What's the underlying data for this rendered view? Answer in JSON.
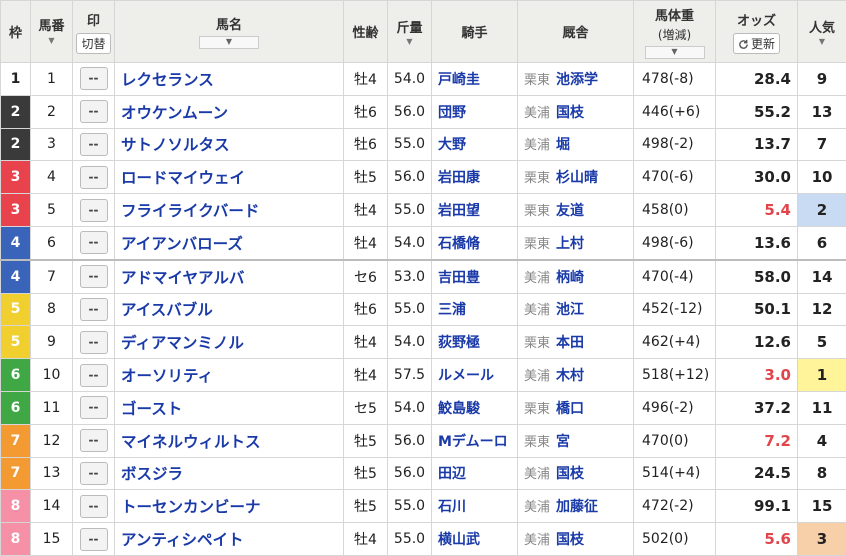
{
  "header": {
    "waku": "枠",
    "umaban": "馬番",
    "mark": "印",
    "mark_switch": "切替",
    "name": "馬名",
    "sexage": "性齢",
    "kinryo": "斤量",
    "jockey": "騎手",
    "stable": "厩舎",
    "weight": "馬体重",
    "weight_sub": "(増減)",
    "odds": "オッズ",
    "refresh": "更新",
    "popularity": "人気"
  },
  "rows": [
    {
      "waku": "1",
      "umaban": "1",
      "mark": "--",
      "name": "レクセランス",
      "sexage": "牡4",
      "kinryo": "54.0",
      "jockey": "戸崎圭",
      "belong": "栗東",
      "trainer": "池添学",
      "weight": "478(-8)",
      "odds": "28.4",
      "pop": "9"
    },
    {
      "waku": "2",
      "umaban": "2",
      "mark": "--",
      "name": "オウケンムーン",
      "sexage": "牡6",
      "kinryo": "56.0",
      "jockey": "団野",
      "belong": "美浦",
      "trainer": "国枝",
      "weight": "446(+6)",
      "odds": "55.2",
      "pop": "13"
    },
    {
      "waku": "2",
      "umaban": "3",
      "mark": "--",
      "name": "サトノソルタス",
      "sexage": "牡6",
      "kinryo": "55.0",
      "jockey": "大野",
      "belong": "美浦",
      "trainer": "堀",
      "weight": "498(-2)",
      "odds": "13.7",
      "pop": "7"
    },
    {
      "waku": "3",
      "umaban": "4",
      "mark": "--",
      "name": "ロードマイウェイ",
      "sexage": "牡5",
      "kinryo": "56.0",
      "jockey": "岩田康",
      "belong": "栗東",
      "trainer": "杉山晴",
      "weight": "470(-6)",
      "odds": "30.0",
      "pop": "10"
    },
    {
      "waku": "3",
      "umaban": "5",
      "mark": "--",
      "name": "フライライクバード",
      "sexage": "牡4",
      "kinryo": "55.0",
      "jockey": "岩田望",
      "belong": "栗東",
      "trainer": "友道",
      "weight": "458(0)",
      "odds": "5.4",
      "pop": "2"
    },
    {
      "waku": "4",
      "umaban": "6",
      "mark": "--",
      "name": "アイアンバローズ",
      "sexage": "牡4",
      "kinryo": "54.0",
      "jockey": "石橋脩",
      "belong": "栗東",
      "trainer": "上村",
      "weight": "498(-6)",
      "odds": "13.6",
      "pop": "6"
    },
    {
      "waku": "4",
      "umaban": "7",
      "mark": "--",
      "name": "アドマイヤアルバ",
      "sexage": "セ6",
      "kinryo": "53.0",
      "jockey": "吉田豊",
      "belong": "美浦",
      "trainer": "柄崎",
      "weight": "470(-4)",
      "odds": "58.0",
      "pop": "14"
    },
    {
      "waku": "5",
      "umaban": "8",
      "mark": "--",
      "name": "アイスバブル",
      "sexage": "牡6",
      "kinryo": "55.0",
      "jockey": "三浦",
      "belong": "美浦",
      "trainer": "池江",
      "weight": "452(-12)",
      "odds": "50.1",
      "pop": "12"
    },
    {
      "waku": "5",
      "umaban": "9",
      "mark": "--",
      "name": "ディアマンミノル",
      "sexage": "牡4",
      "kinryo": "54.0",
      "jockey": "荻野極",
      "belong": "栗東",
      "trainer": "本田",
      "weight": "462(+4)",
      "odds": "12.6",
      "pop": "5"
    },
    {
      "waku": "6",
      "umaban": "10",
      "mark": "--",
      "name": "オーソリティ",
      "sexage": "牡4",
      "kinryo": "57.5",
      "jockey": "ルメール",
      "belong": "美浦",
      "trainer": "木村",
      "weight": "518(+12)",
      "odds": "3.0",
      "pop": "1"
    },
    {
      "waku": "6",
      "umaban": "11",
      "mark": "--",
      "name": "ゴースト",
      "sexage": "セ5",
      "kinryo": "54.0",
      "jockey": "鮫島駿",
      "belong": "栗東",
      "trainer": "橋口",
      "weight": "496(-2)",
      "odds": "37.2",
      "pop": "11"
    },
    {
      "waku": "7",
      "umaban": "12",
      "mark": "--",
      "name": "マイネルウィルトス",
      "sexage": "牡5",
      "kinryo": "56.0",
      "jockey": "Mデムーロ",
      "belong": "栗東",
      "trainer": "宮",
      "weight": "470(0)",
      "odds": "7.2",
      "pop": "4"
    },
    {
      "waku": "7",
      "umaban": "13",
      "mark": "--",
      "name": "ボスジラ",
      "sexage": "牡5",
      "kinryo": "56.0",
      "jockey": "田辺",
      "belong": "美浦",
      "trainer": "国枝",
      "weight": "514(+4)",
      "odds": "24.5",
      "pop": "8"
    },
    {
      "waku": "8",
      "umaban": "14",
      "mark": "--",
      "name": "トーセンカンビーナ",
      "sexage": "牡5",
      "kinryo": "55.0",
      "jockey": "石川",
      "belong": "美浦",
      "trainer": "加藤征",
      "weight": "472(-2)",
      "odds": "99.1",
      "pop": "15"
    },
    {
      "waku": "8",
      "umaban": "15",
      "mark": "--",
      "name": "アンティシペイト",
      "sexage": "牡4",
      "kinryo": "55.0",
      "jockey": "横山武",
      "belong": "美浦",
      "trainer": "国枝",
      "weight": "502(0)",
      "odds": "5.6",
      "pop": "3"
    }
  ]
}
